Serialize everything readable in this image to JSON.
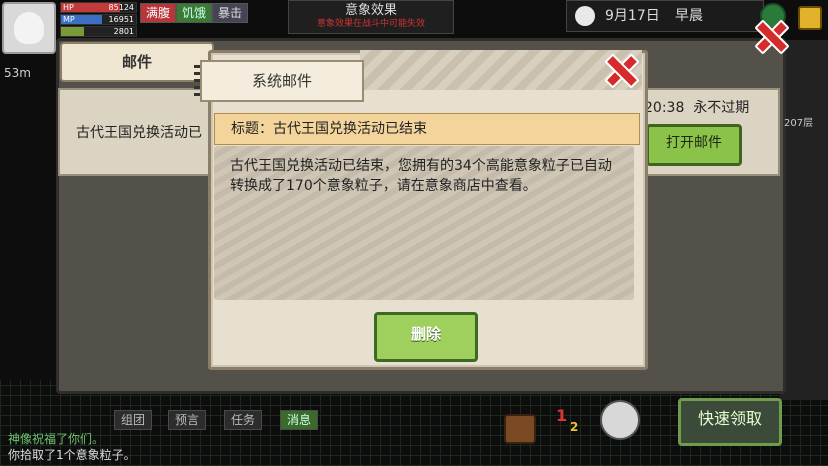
{
  "hud": {
    "hp_label": "HP",
    "hp_value": "85124",
    "hp_fill": 0.78,
    "mp_label": "MP",
    "mp_value": "16951",
    "mp_fill": 0.55,
    "sp_value": "2801",
    "sp_fill": 0.3,
    "tags": [
      "满腹",
      "饥饿",
      "暴击"
    ],
    "distance": "53m"
  },
  "top_center": {
    "title": "意象效果",
    "subtitle": "意象效果在战斗中可能失效"
  },
  "top_right": {
    "date": "9月17日",
    "period": "早晨"
  },
  "back_panel": {
    "tab_label": "邮件",
    "row_title": "古代王国兑换活动已",
    "row_time": "20:38",
    "row_expire": "永不过期",
    "open_button": "打开邮件",
    "side_text": "207层"
  },
  "dialog": {
    "banner_label": "系统邮件",
    "title": "标题：古代王国兑换活动已结束",
    "body": "古代王国兑换活动已结束，您拥有的34个高能意象粒子已自动转换成了170个意象粒子，请在意象商店中查看。",
    "delete_button": "删除"
  },
  "bottom": {
    "tabs": [
      "组团",
      "预言",
      "任务",
      "消息"
    ],
    "chat": [
      "神像祝福了你们。",
      "你拾取了1个意象粒子。"
    ],
    "fast_button": "快速领取",
    "count": "1",
    "count2": "2"
  },
  "colors": {
    "accent_green": "#8ac24a",
    "close_red": "#d52b2b",
    "ribbon": "#f3d49b"
  }
}
